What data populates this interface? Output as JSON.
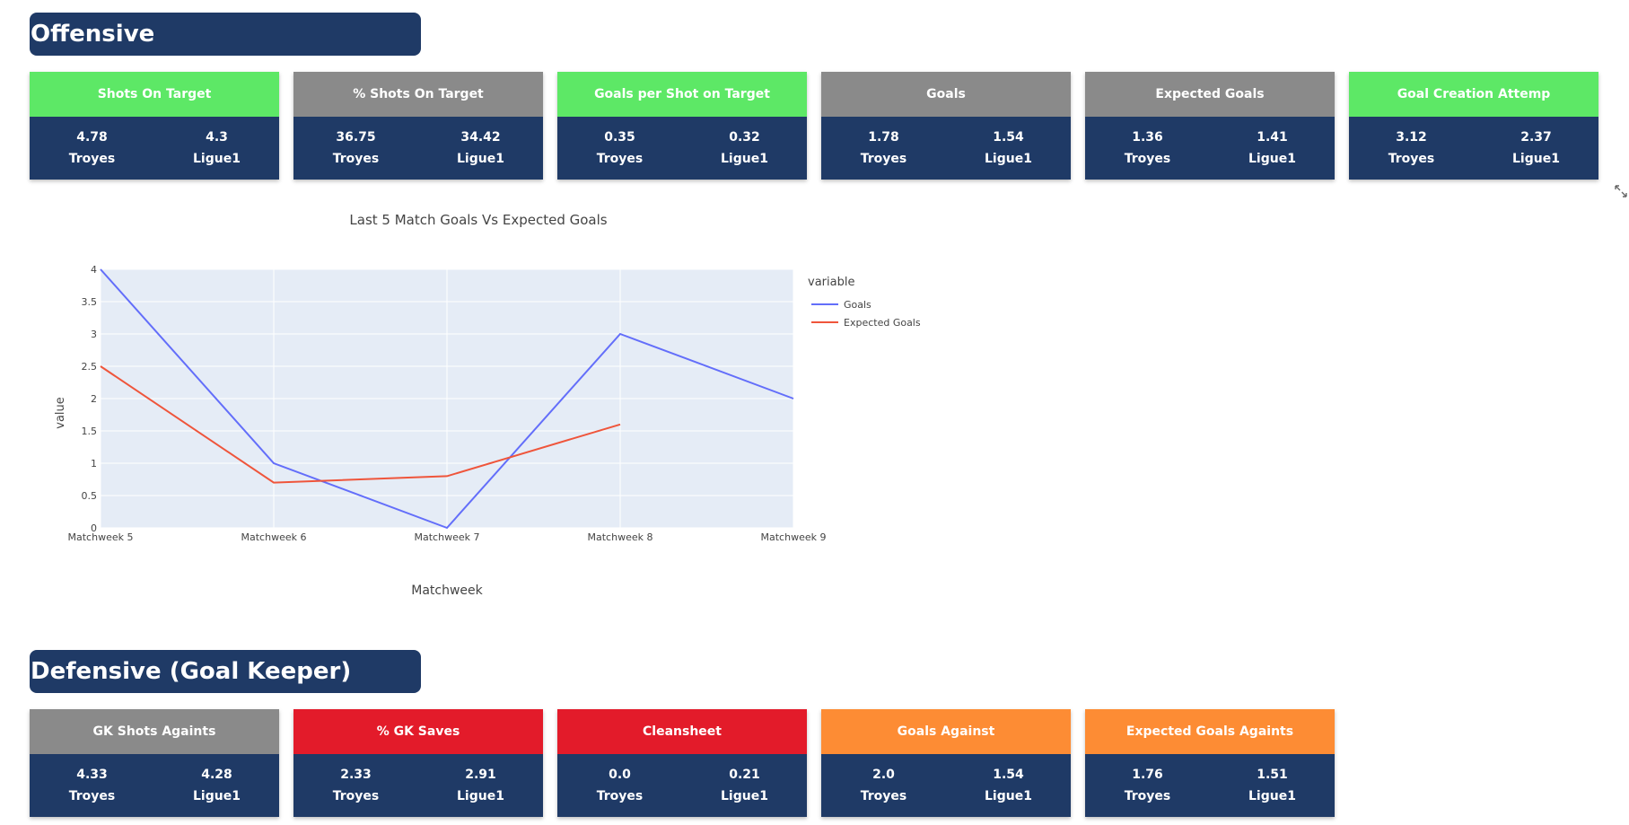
{
  "offensive": {
    "title": "Offensive",
    "cards": [
      {
        "label": "Shots On Target",
        "color": "#5de866",
        "team_value": "4.78",
        "league_value": "4.3",
        "team": "Troyes",
        "league": "Ligue1"
      },
      {
        "label": "% Shots On Target",
        "color": "#8a8a8a",
        "team_value": "36.75",
        "league_value": "34.42",
        "team": "Troyes",
        "league": "Ligue1"
      },
      {
        "label": "Goals per Shot on Target",
        "color": "#5de866",
        "team_value": "0.35",
        "league_value": "0.32",
        "team": "Troyes",
        "league": "Ligue1"
      },
      {
        "label": "Goals",
        "color": "#8a8a8a",
        "team_value": "1.78",
        "league_value": "1.54",
        "team": "Troyes",
        "league": "Ligue1"
      },
      {
        "label": "Expected Goals",
        "color": "#8a8a8a",
        "team_value": "1.36",
        "league_value": "1.41",
        "team": "Troyes",
        "league": "Ligue1"
      },
      {
        "label": "Goal Creation Attemp",
        "color": "#5de866",
        "team_value": "3.12",
        "league_value": "2.37",
        "team": "Troyes",
        "league": "Ligue1"
      }
    ]
  },
  "defensive": {
    "title": "Defensive (Goal Keeper)",
    "cards": [
      {
        "label": "GK Shots Againts",
        "color": "#8a8a8a",
        "team_value": "4.33",
        "league_value": "4.28",
        "team": "Troyes",
        "league": "Ligue1"
      },
      {
        "label": "% GK Saves",
        "color": "#e31b2a",
        "team_value": "2.33",
        "league_value": "2.91",
        "team": "Troyes",
        "league": "Ligue1"
      },
      {
        "label": "Cleansheet",
        "color": "#e31b2a",
        "team_value": "0.0",
        "league_value": "0.21",
        "team": "Troyes",
        "league": "Ligue1"
      },
      {
        "label": "Goals Against",
        "color": "#fd8c34",
        "team_value": "2.0",
        "league_value": "1.54",
        "team": "Troyes",
        "league": "Ligue1"
      },
      {
        "label": "Expected Goals Againts",
        "color": "#fd8c34",
        "team_value": "1.76",
        "league_value": "1.51",
        "team": "Troyes",
        "league": "Ligue1"
      }
    ]
  },
  "chart_data": {
    "type": "line",
    "title": "Last 5 Match Goals Vs Expected Goals",
    "xlabel": "Matchweek",
    "ylabel": "value",
    "legend_title": "variable",
    "legend_position": "top-right",
    "categories": [
      "Matchweek 5",
      "Matchweek 6",
      "Matchweek 7",
      "Matchweek 8",
      "Matchweek 9"
    ],
    "yticks": [
      "0",
      "0.5",
      "1",
      "1.5",
      "2",
      "2.5",
      "3",
      "3.5",
      "4"
    ],
    "ylim": [
      0,
      4
    ],
    "grid": true,
    "series": [
      {
        "name": "Goals",
        "color": "#636efa",
        "values": [
          4,
          1,
          0,
          3,
          2
        ]
      },
      {
        "name": "Expected Goals",
        "color": "#ef553b",
        "values": [
          2.5,
          0.7,
          0.8,
          1.6,
          null
        ]
      }
    ]
  },
  "icons": {
    "expand": "expand-icon"
  }
}
